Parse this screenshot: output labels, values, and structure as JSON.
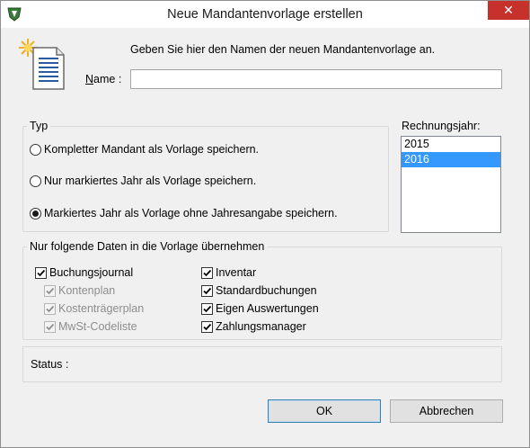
{
  "window": {
    "title": "Neue Mandantenvorlage erstellen",
    "close_glyph": "✕"
  },
  "header": {
    "intro_text": "Geben Sie hier den Namen der neuen Mandantenvorlage an.",
    "name_label_accel": "N",
    "name_label_rest": "ame :",
    "name_value": ""
  },
  "typ": {
    "title": "Typ",
    "options": [
      {
        "label": "Kompletter Mandant als Vorlage speichern.",
        "selected": false
      },
      {
        "label": "Nur markiertes Jahr als Vorlage speichern.",
        "selected": false
      },
      {
        "label": "Markiertes Jahr als Vorlage ohne Jahresangabe speichern.",
        "selected": true
      }
    ]
  },
  "rechnungsjahr": {
    "label": "Rechnungsjahr:",
    "years": [
      "2015",
      "2016"
    ],
    "selected": "2016"
  },
  "daten": {
    "title": "Nur folgende Daten in die Vorlage übernehmen",
    "left": [
      {
        "label": "Buchungsjournal",
        "checked": true,
        "enabled": true
      },
      {
        "label": "Kontenplan",
        "checked": true,
        "enabled": false
      },
      {
        "label": "Kostenträgerplan",
        "checked": true,
        "enabled": false
      },
      {
        "label": "MwSt-Codeliste",
        "checked": true,
        "enabled": false
      }
    ],
    "right": [
      {
        "label": "Inventar",
        "checked": true,
        "enabled": true
      },
      {
        "label": "Standardbuchungen",
        "checked": true,
        "enabled": true
      },
      {
        "label": "Eigen Auswertungen",
        "checked": true,
        "enabled": true
      },
      {
        "label": "Zahlungsmanager",
        "checked": true,
        "enabled": true
      }
    ]
  },
  "status": {
    "label": "Status :"
  },
  "buttons": {
    "ok": "OK",
    "cancel": "Abbrechen"
  },
  "icons": {
    "app": "app-shield-icon",
    "document": "new-document-icon",
    "close": "close-icon"
  }
}
